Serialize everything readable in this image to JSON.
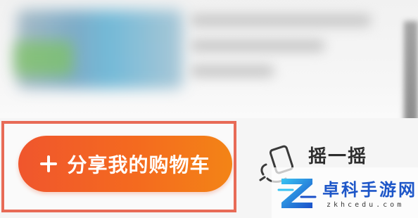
{
  "share_button": {
    "label": "分享我的购物车",
    "icon": "plus-icon"
  },
  "shake": {
    "label": "摇一摇",
    "icon": "shake-phone-icon"
  },
  "watermark": {
    "title": "卓科手游网",
    "url": "zkhcedu.com"
  },
  "colors": {
    "button_start": "#f0562d",
    "button_end": "#f38416",
    "highlight_frame": "#e86b57",
    "watermark_blue": "#1d56c8"
  }
}
